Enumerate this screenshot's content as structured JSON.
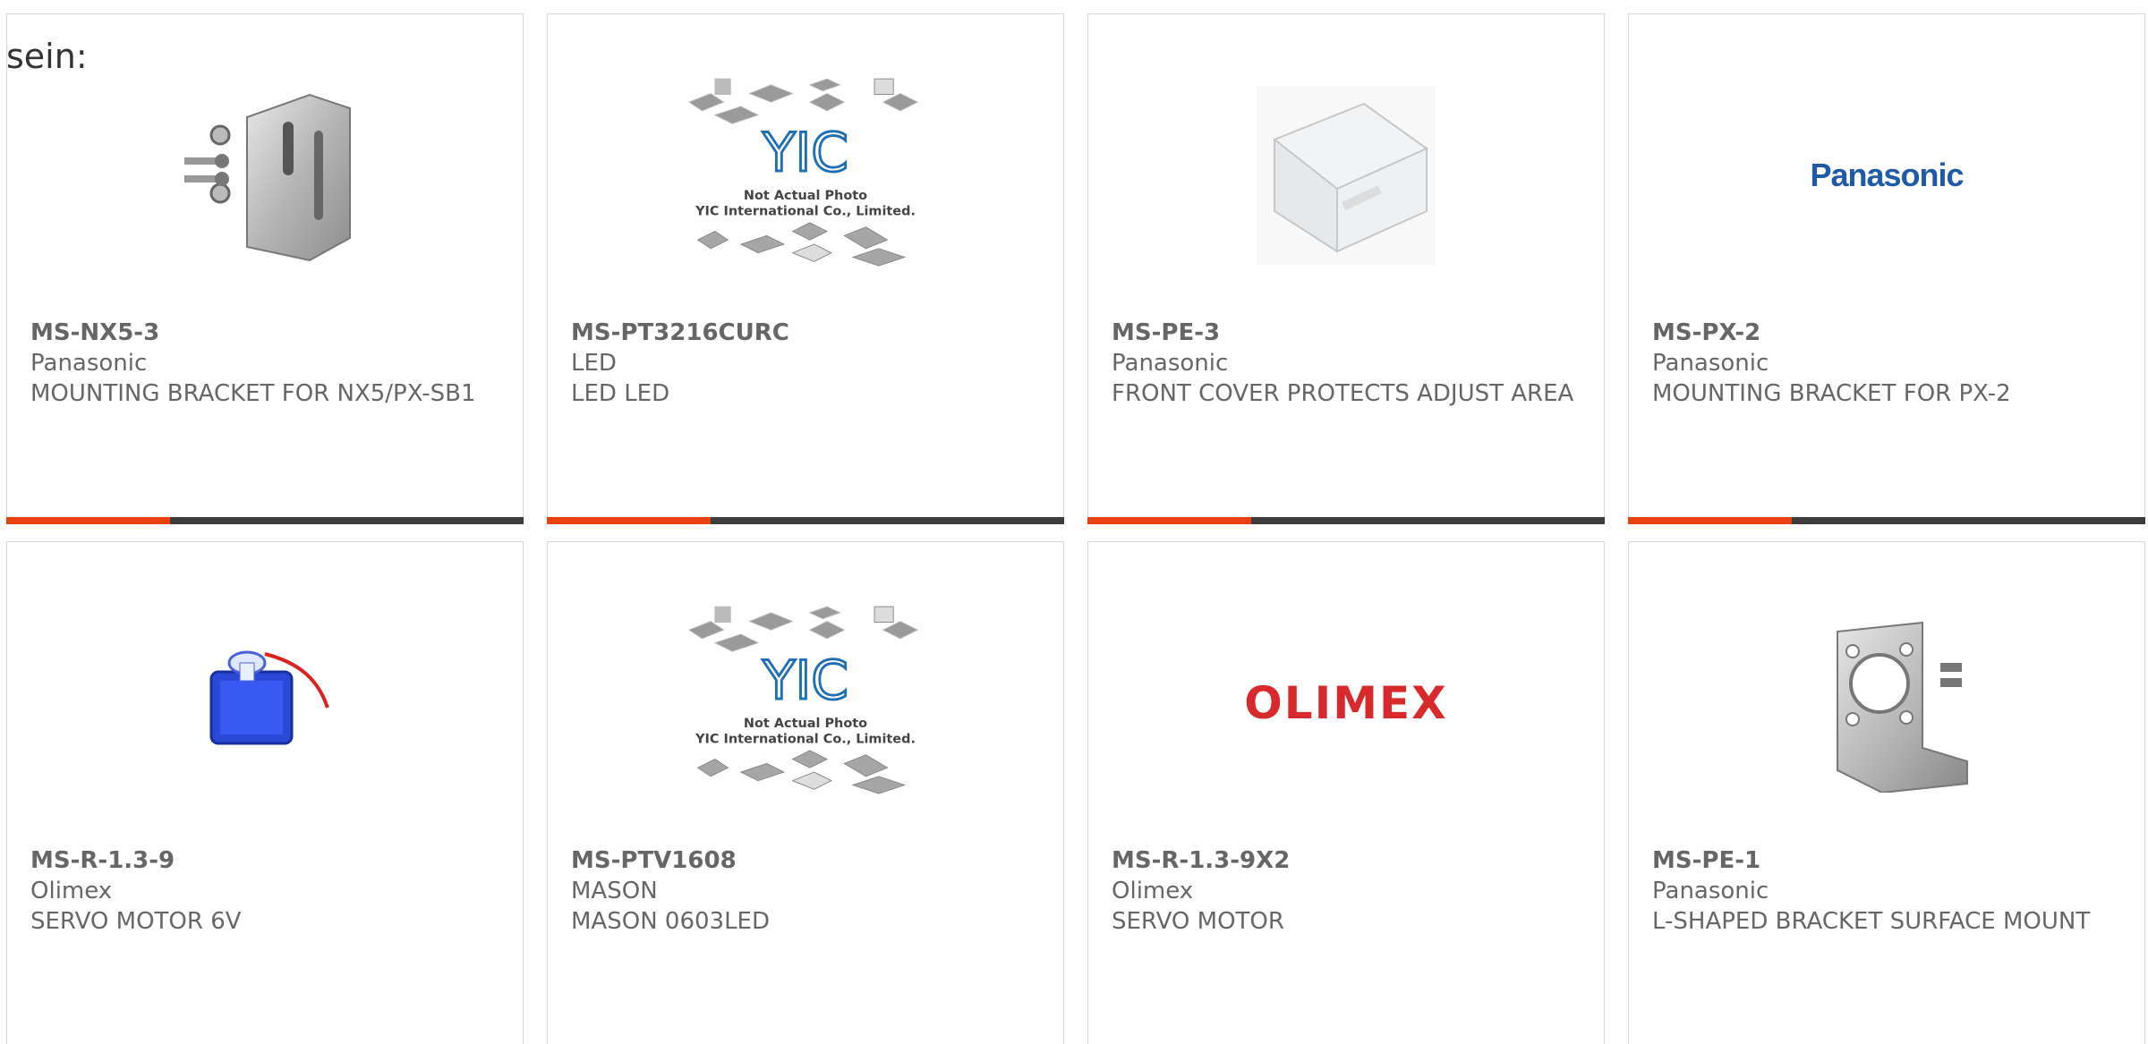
{
  "lead_text": "sein:",
  "colors": {
    "accent": "#e8410d",
    "bar": "#3d3d3d",
    "text": "#666666"
  },
  "products": [
    {
      "part": "MS-NX5-3",
      "maker": "Panasonic",
      "desc": "MOUNTING BRACKET FOR NX5/PX-SB1",
      "image": "steel-bracket-with-screws"
    },
    {
      "part": "MS-PT3216CURC",
      "maker": "LED",
      "desc": "LED LED",
      "image": "yic-placeholder",
      "placeholder_lines": [
        "Not Actual Photo",
        "YIC International Co., Limited."
      ]
    },
    {
      "part": "MS-PE-3",
      "maker": "Panasonic",
      "desc": "FRONT COVER PROTECTS ADJUST AREA",
      "image": "clear-plastic-cover"
    },
    {
      "part": "MS-PX-2",
      "maker": "Panasonic",
      "desc": "MOUNTING BRACKET FOR PX-2",
      "image": "panasonic-logo",
      "logo_text": "Panasonic"
    },
    {
      "part": "MS-R-1.3-9",
      "maker": "Olimex",
      "desc": "SERVO MOTOR 6V",
      "image": "blue-servo-motor"
    },
    {
      "part": "MS-PTV1608",
      "maker": "MASON",
      "desc": "MASON 0603LED",
      "image": "yic-placeholder",
      "placeholder_lines": [
        "Not Actual Photo",
        "YIC International Co., Limited."
      ]
    },
    {
      "part": "MS-R-1.3-9X2",
      "maker": "Olimex",
      "desc": "SERVO MOTOR",
      "image": "olimex-logo",
      "logo_text": "OLIMEX"
    },
    {
      "part": "MS-PE-1",
      "maker": "Panasonic",
      "desc": "L-SHAPED BRACKET SURFACE MOUNT",
      "image": "l-shaped-bracket"
    }
  ]
}
